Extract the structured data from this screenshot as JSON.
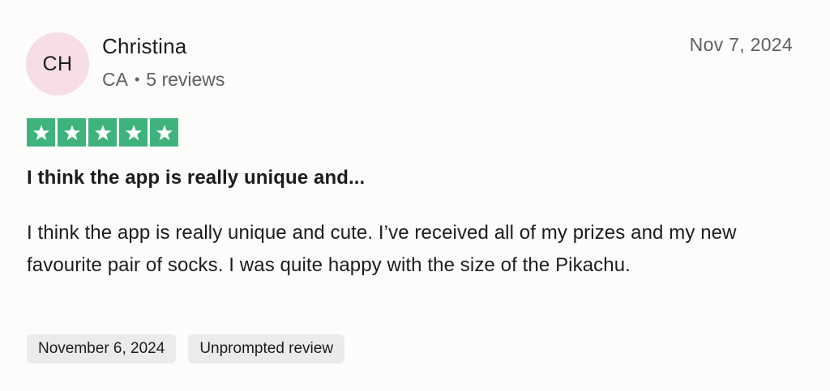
{
  "review": {
    "avatar_initials": "CH",
    "avatar_color": "#f6dde6",
    "reviewer_name": "Christina",
    "country": "CA",
    "separator": "•",
    "review_count": "5 reviews",
    "date": "Nov 7, 2024",
    "rating": 5,
    "rating_max": 5,
    "star_color": "#3fb37c",
    "title": "I think the app is really unique and...",
    "body": "I think the app is really unique and cute. I’ve received all of my prizes and my new favourite pair of socks. I was quite happy with the size of the Pikachu.",
    "tags": [
      "November 6, 2024",
      "Unprompted review"
    ]
  }
}
